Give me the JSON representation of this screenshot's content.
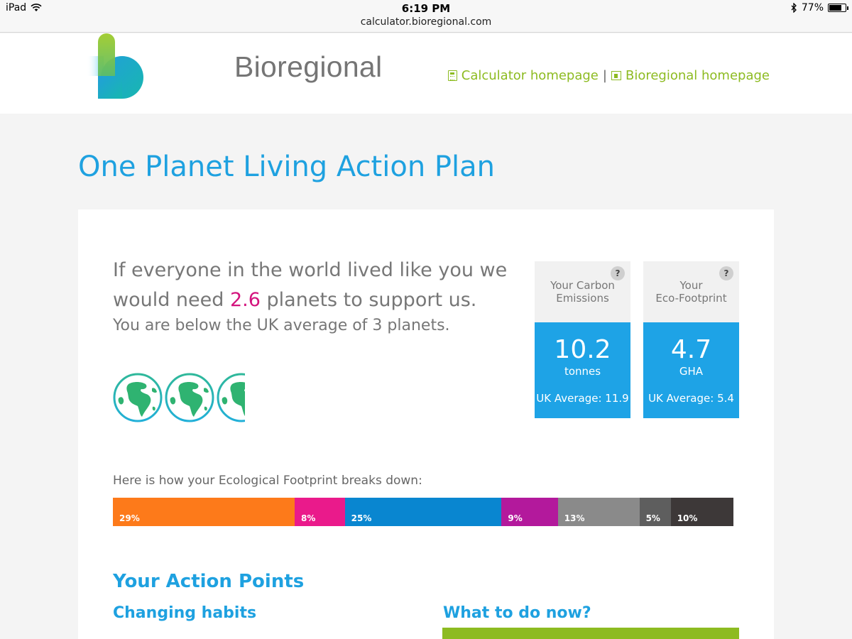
{
  "status_bar": {
    "device": "iPad",
    "time": "6:19 PM",
    "url": "calculator.bioregional.com",
    "battery": "77%",
    "battery_level": 0.77
  },
  "header": {
    "logo_text": "Bioregional",
    "links": [
      {
        "label": "Calculator homepage",
        "icon": "calculator-icon"
      },
      {
        "label": "Bioregional homepage",
        "icon": "building-icon"
      }
    ],
    "separator": "|",
    "link_color": "#8dbb21"
  },
  "page_title": "One Planet Living Action Plan",
  "intro": {
    "line1": "If everyone in the world lived like you we",
    "line2_prefix": "would need ",
    "planets": "2.6",
    "line2_suffix": " planets to support us.",
    "sub": "You are below the UK average of 3 planets.",
    "planets_value": 2.6
  },
  "stats": [
    {
      "title_line1": "Your Carbon",
      "title_line2": "Emissions",
      "help": "?",
      "value": "10.2",
      "unit": "tonnes",
      "average": "UK Average: 11.9"
    },
    {
      "title_line1": "Your",
      "title_line2": "Eco-Footprint",
      "help": "?",
      "value": "4.7",
      "unit": "GHA",
      "average": "UK Average: 5.4"
    }
  ],
  "breakdown": {
    "label": "Here is how your Ecological Footprint breaks down:",
    "segments": [
      {
        "label": "29%",
        "value": 29,
        "color": "#fd7a1a"
      },
      {
        "label": "8%",
        "value": 8,
        "color": "#ea1a8b"
      },
      {
        "label": "25%",
        "value": 25,
        "color": "#0986d0"
      },
      {
        "label": "9%",
        "value": 9,
        "color": "#b3199c"
      },
      {
        "label": "13%",
        "value": 13,
        "color": "#8a8a8a"
      },
      {
        "label": "5%",
        "value": 5,
        "color": "#5e5e5e"
      },
      {
        "label": "10%",
        "value": 10,
        "color": "#3d3838"
      }
    ]
  },
  "actions": {
    "heading": "Your Action Points",
    "habits_heading": "Changing habits",
    "now_heading": "What to do now?"
  },
  "colors": {
    "accent_blue": "#1ea1e0",
    "stat_blue": "#1ea3e6",
    "highlight_pink": "#d4147e",
    "green": "#8dbb21"
  }
}
